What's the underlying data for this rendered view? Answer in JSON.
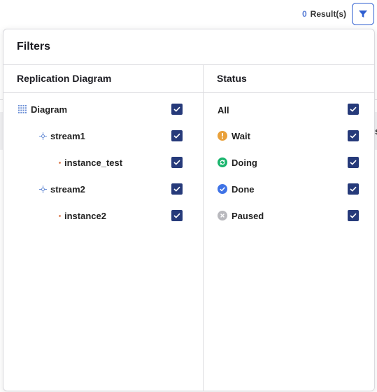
{
  "topbar": {
    "result_count": "0",
    "result_label": "Result(s)",
    "filter_button_icon": "filter-icon"
  },
  "background": {
    "right_edge_fragment": "s"
  },
  "panel": {
    "title": "Filters",
    "replication": {
      "header": "Replication Diagram",
      "items": [
        {
          "label": "Diagram",
          "icon": "grid-dots-icon",
          "checked": true
        },
        {
          "label": "stream1",
          "icon": "stream-node-icon",
          "checked": true
        },
        {
          "label": "instance_test",
          "icon": "dot-icon",
          "checked": true
        },
        {
          "label": "stream2",
          "icon": "stream-node-icon",
          "checked": true
        },
        {
          "label": "instance2",
          "icon": "dot-icon",
          "checked": true
        }
      ]
    },
    "status": {
      "header": "Status",
      "items": [
        {
          "label": "All",
          "icon": "",
          "checked": true
        },
        {
          "label": "Wait",
          "icon": "warning-icon",
          "color": "#e9a13b",
          "checked": true
        },
        {
          "label": "Doing",
          "icon": "refresh-icon",
          "color": "#1bb56e",
          "checked": true
        },
        {
          "label": "Done",
          "icon": "check-circle-icon",
          "color": "#3f73e6",
          "checked": true
        },
        {
          "label": "Paused",
          "icon": "x-circle-icon",
          "color": "#b9b9be",
          "checked": true
        }
      ]
    }
  },
  "colors": {
    "accent": "#2f5fd1",
    "checkbox": "#263a7a",
    "count": "#5b7fd6"
  }
}
